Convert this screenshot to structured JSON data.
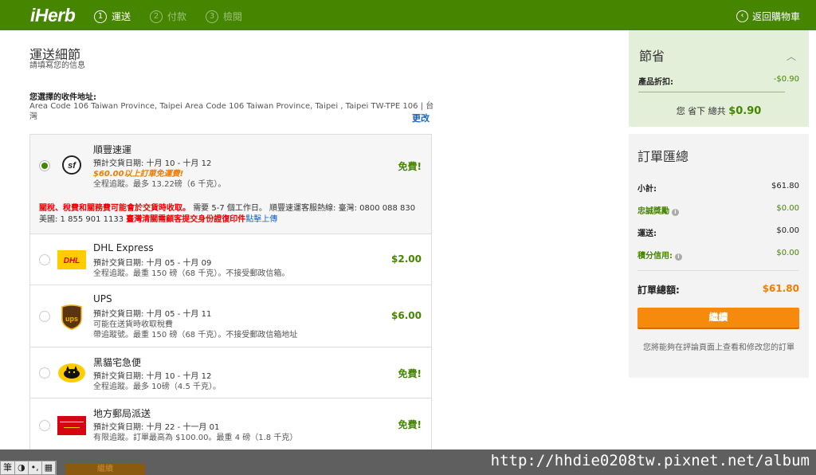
{
  "header": {
    "logo": "iHerb",
    "steps": [
      {
        "num": "1",
        "label": "運送"
      },
      {
        "num": "2",
        "label": "付款"
      },
      {
        "num": "3",
        "label": "檢閱"
      }
    ],
    "back_label": "返回購物車",
    "back_icon": "‹"
  },
  "shipping": {
    "title": "運送細節",
    "subtitle": "請填寫您的信息",
    "address_label": "您選擇的收件地址:",
    "address_text": "Area Code 106 Taiwan Province, Taipei Area Code 106 Taiwan Province, Taipei , Taipei TW-TPE 106 | 台灣",
    "change_link": "更改",
    "options": [
      {
        "name": "順豐速運",
        "date": "預計交貨日期: 十月 10 - 十月 12",
        "promo": "$60.00以上訂單免運費!",
        "detail": "全程追蹤。最多 13.22磅（6 千克）。",
        "price": "免費!",
        "selected": true,
        "note_red1": "關稅、稅費和關務費可能會於交貨時收取。",
        "note_text1": "需要 5-7 個工作日。 順豐速運客服熱線: 臺灣: 0800 088 830 美國: 1 855 901 1133",
        "note_red2": "臺灣清關需顧客提交身份證復印件",
        "note_link": "點擊上傳"
      },
      {
        "name": "DHL Express",
        "date": "預計交貨日期: 十月 05 - 十月 09",
        "detail": "全程追蹤。最重 150 磅（68 千克）。不接受郵政信箱。",
        "price": "$2.00",
        "selected": false
      },
      {
        "name": "UPS",
        "date": "預計交貨日期: 十月 05 - 十月 11",
        "detail2": "可能在送貨時收取稅費",
        "detail": "帶追蹤號。最重 150 磅（68 千克）。不接受郵政信箱地址",
        "price": "$6.00",
        "selected": false
      },
      {
        "name": "黑貓宅急便",
        "date": "預計交貨日期: 十月 10 - 十月 12",
        "detail": "全程追蹤。最多 10磅（4.5 千克）。",
        "price": "免費!",
        "selected": false
      },
      {
        "name": "地方郵局派送",
        "date": "預計交貨日期: 十月 22 - 十一月 01",
        "detail": "有限追蹤。訂單最高為 $100.00。最重 4 磅（1.8 千克）",
        "price": "免費!",
        "selected": false
      }
    ]
  },
  "savings": {
    "title": "節省",
    "discount_label": "產品折扣:",
    "discount_value": "-$0.90",
    "total_prefix": "您 省下 總共",
    "total_value": "$0.90"
  },
  "summary": {
    "title": "訂單匯總",
    "rows": [
      {
        "label": "小計:",
        "value": "$61.80"
      },
      {
        "label": "忠誠獎勵",
        "value": "$0.00",
        "info": "i"
      },
      {
        "label": "運送:",
        "value": "$0.00"
      },
      {
        "label": "積分信用:",
        "value": "$0.00",
        "info": "i"
      }
    ],
    "total_label": "訂單總額:",
    "total_value": "$61.80",
    "continue": "繼續",
    "footer": "您將能夠在評論頁面上查看和修改您的訂單"
  },
  "overlay": {
    "ime": [
      "筆",
      "◑",
      "•,",
      "▦"
    ],
    "button": "繼續",
    "watermark": "http://hhdie0208tw.pixnet.net/album"
  }
}
